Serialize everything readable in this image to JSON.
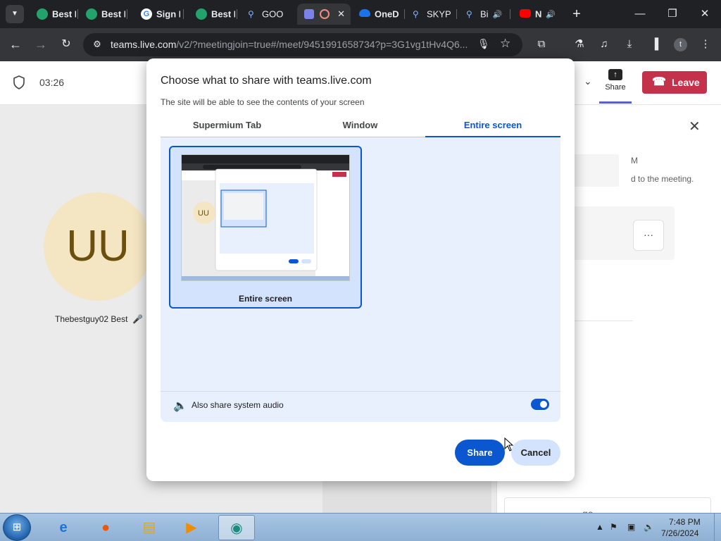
{
  "browser": {
    "tabs": [
      {
        "title": "Best I",
        "favicon_color": "#22a36b",
        "active": false
      },
      {
        "title": "Best I",
        "favicon_color": "#22a36b",
        "active": false
      },
      {
        "title": "Sign I",
        "favicon_color": "#ffffff",
        "favicon_letter": "G",
        "active": false
      },
      {
        "title": "Best I",
        "favicon_color": "#22a36b",
        "active": false
      },
      {
        "title": "GOO",
        "favicon_color": "#8ab4f8",
        "favicon_letter": "Q",
        "active": false
      },
      {
        "title": "",
        "favicon_color": "#7b83eb",
        "active": true,
        "recording": true
      },
      {
        "title": "OneD",
        "favicon_color": "#1a73e8",
        "active": false
      },
      {
        "title": "SKYP",
        "favicon_color": "#8ab4f8",
        "favicon_letter": "Q",
        "active": false
      },
      {
        "title": "Bi",
        "favicon_color": "#8ab4f8",
        "favicon_letter": "Q",
        "active": false,
        "audio": true
      },
      {
        "title": "N",
        "favicon_color": "#ff0000",
        "active": false,
        "audio": true
      }
    ],
    "tab_close_glyph": "✕",
    "new_tab_glyph": "+",
    "url_host": "teams.live.com",
    "url_rest": "/v2/?meetingjoin=true#/meet/9451991658734?p=3G1vg1tHv4Q6...",
    "profile_initial": "t"
  },
  "meeting": {
    "timer": "03:26",
    "share_label": "Share",
    "leave_label": "Leave",
    "participant_initials": "UU",
    "participant_name": "Thebestguy02 Best"
  },
  "chat": {
    "msg_initial": "M",
    "msg_text": "d to the meeting.",
    "more_glyph": "···",
    "compose_placeholder": "ge"
  },
  "dialog": {
    "title": "Choose what to share with teams.live.com",
    "subtitle": "The site will be able to see the contents of your screen",
    "tabs": [
      "Supermium Tab",
      "Window",
      "Entire screen"
    ],
    "active_tab_index": 2,
    "screen_option_label": "Entire screen",
    "thumb_initials": "UU",
    "audio_label": "Also share system audio",
    "audio_enabled": true,
    "share_button": "Share",
    "cancel_button": "Cancel"
  },
  "taskbar": {
    "time": "7:48 PM",
    "date": "7/26/2024",
    "apps": [
      "internet-explorer",
      "firefox",
      "file-explorer",
      "media-player",
      "teams"
    ]
  },
  "colors": {
    "accent_blue": "#0b57d0",
    "leave_red": "#c4314b",
    "teams_purple": "#5b5fc7"
  }
}
